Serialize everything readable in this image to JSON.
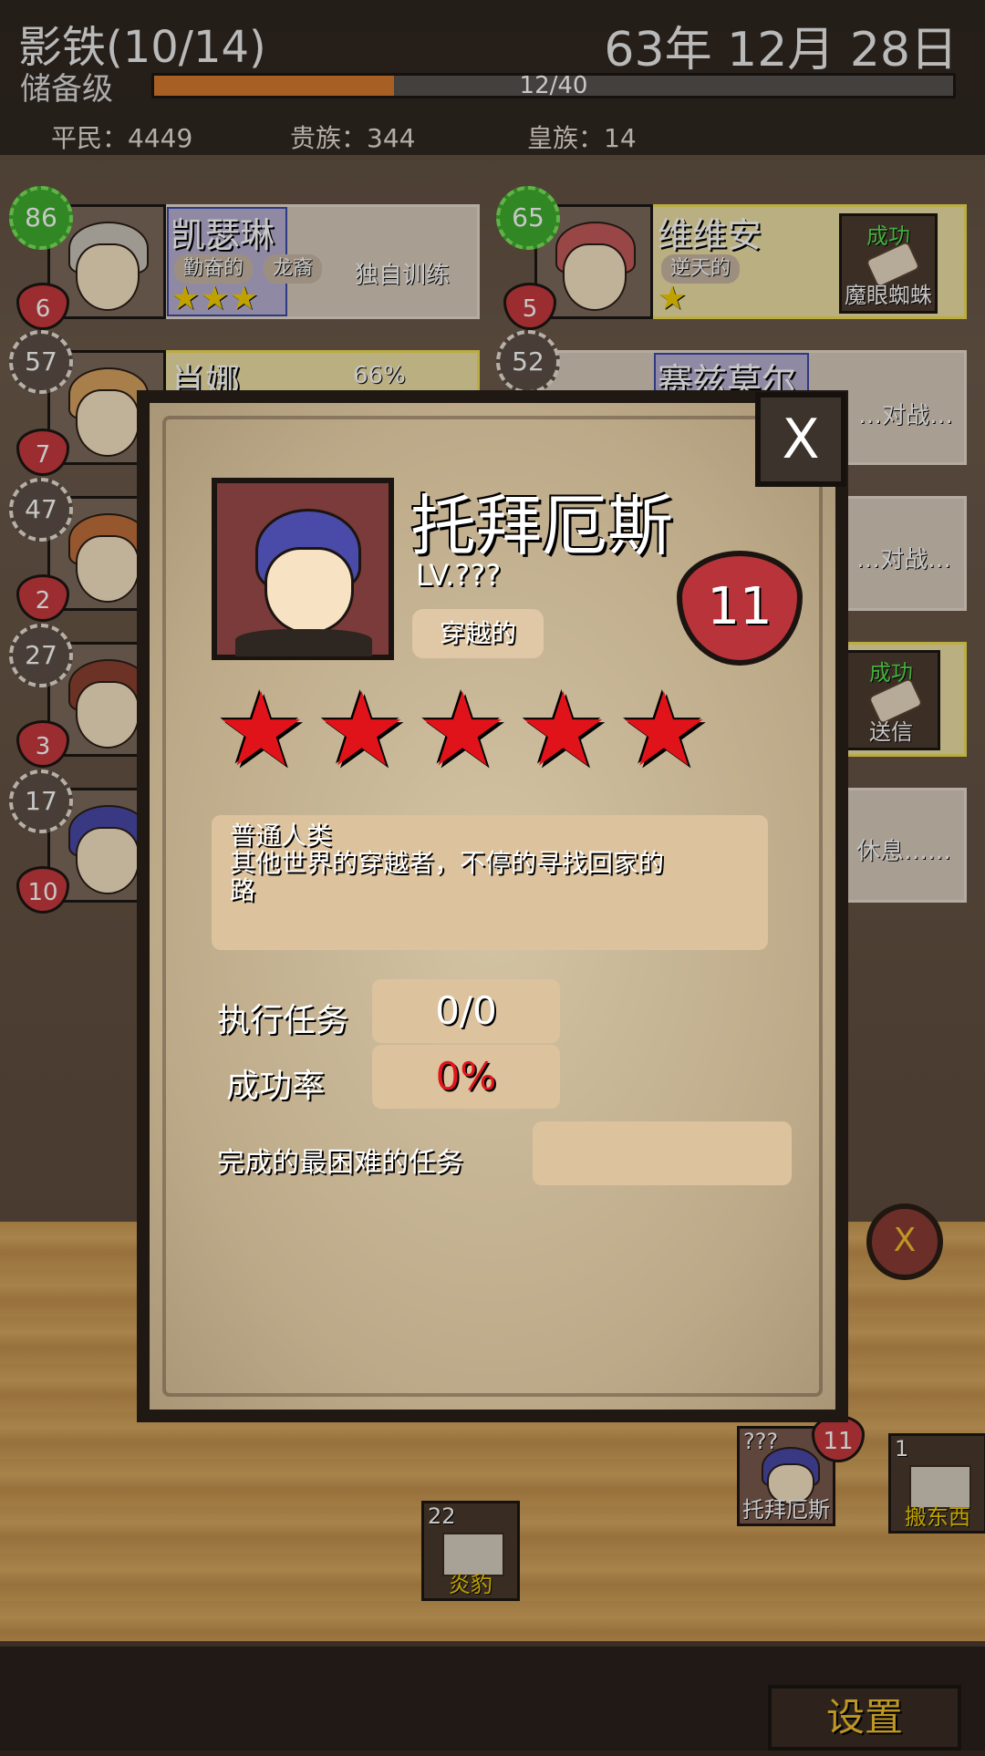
{
  "hud": {
    "guild_title": "影铁(10/14)",
    "date": "63年 12月 28日",
    "rank": "储备级",
    "progress_text": "12/40",
    "progress_fraction": 0.3,
    "commoners": "平民：4449",
    "nobles": "贵族：344",
    "royals": "皇族：14"
  },
  "roster": [
    {
      "level": "86",
      "hearts": "6",
      "name": "凯瑟琳",
      "tags": [
        "勤奋的",
        "龙裔"
      ],
      "status": "独自训练",
      "stars": "★★★"
    },
    {
      "level": "65",
      "hearts": "5",
      "name": "维维安",
      "tags": [
        "逆天的"
      ],
      "stars": "★",
      "quest_result": "成功",
      "quest_name": "魔眼蜘蛛"
    },
    {
      "level": "57",
      "hearts": "7",
      "name": "肖娜",
      "status": "66%"
    },
    {
      "level": "52",
      "name": "赛兹莫尔",
      "status": "…对战…"
    },
    {
      "level": "47",
      "hearts": "2"
    },
    {
      "level": "27",
      "hearts": "3"
    },
    {
      "level": "17",
      "hearts": "10"
    }
  ],
  "right_panels": {
    "battle2": "…对战…",
    "quest_result": "成功",
    "quest_name": "送信",
    "rest": "休息……"
  },
  "floor_items": [
    {
      "count": "22",
      "label": "炎豹"
    },
    {
      "count": "???",
      "hearts": "11",
      "label": "托拜厄斯"
    },
    {
      "count": "1",
      "label": "搬东西"
    }
  ],
  "settings_label": "设置",
  "cancel_label": "X",
  "modal": {
    "close_label": "X",
    "name": "托拜厄斯",
    "level": "LV.???",
    "trait": "穿越的",
    "hearts": "11",
    "stars": [
      "★",
      "★",
      "★",
      "★",
      "★"
    ],
    "desc_line1": "普通人类",
    "desc_line2": "其他世界的穿越者，不停的寻找回家的",
    "desc_line3": "路",
    "quests_label": "执行任务",
    "quests_value": "0/0",
    "success_label": "成功率",
    "success_value": "0%",
    "hardest_label": "完成的最困难的任务",
    "hardest_value": ""
  }
}
